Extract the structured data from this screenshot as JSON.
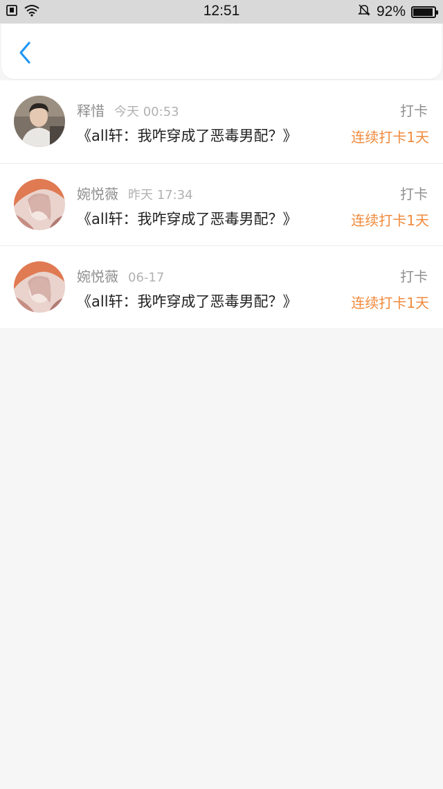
{
  "status_bar": {
    "time": "12:51",
    "battery_percent_text": "92%",
    "battery_level": 0.92,
    "icons": [
      "sim-card-icon",
      "wifi-icon",
      "bell-muted-icon",
      "battery-icon"
    ]
  },
  "nav": {
    "back_icon": "chevron-left-icon",
    "accent": "#2196f3"
  },
  "items": [
    {
      "name": "释惜",
      "time": "今天 00:53",
      "title": "《all轩：我咋穿成了恶毒男配？》",
      "action": "打卡",
      "streak": "连续打卡1天"
    },
    {
      "name": "婉悦薇",
      "time": "昨天 17:34",
      "title": "《all轩：我咋穿成了恶毒男配？》",
      "action": "打卡",
      "streak": "连续打卡1天"
    },
    {
      "name": "婉悦薇",
      "time": "06-17",
      "title": "《all轩：我咋穿成了恶毒男配？》",
      "action": "打卡",
      "streak": "连续打卡1天"
    }
  ],
  "colors": {
    "streak": "#f08a3c",
    "background": "#f6f6f6"
  }
}
